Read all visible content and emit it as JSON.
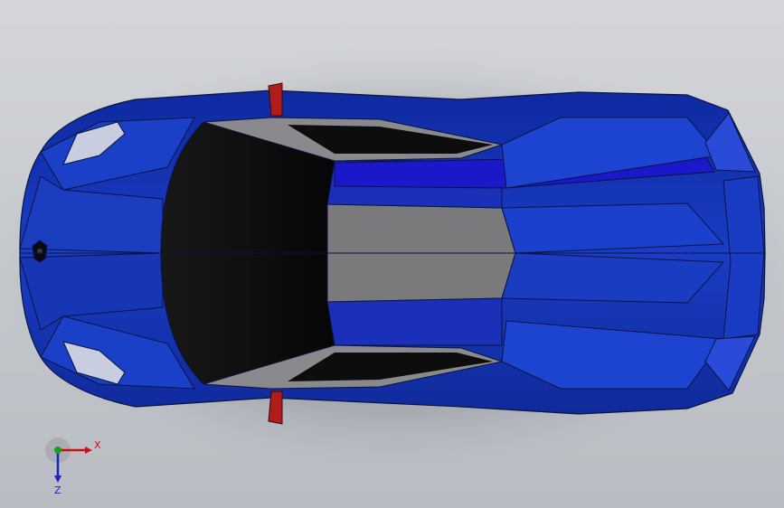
{
  "viewport": {
    "model": "car-top-view",
    "colors": {
      "background_top": "#d4d6da",
      "background_bottom": "#b9bcc2",
      "body_blue": "#1536b8",
      "body_dark_blue": "#0f2a94",
      "stripe_blue": "#1a18c8",
      "glass_black": "#0a0a0a",
      "roof_gray": "#7a7a7c",
      "mirror_red": "#b01c1c",
      "edge_line": "#0a1440"
    }
  },
  "triad": {
    "x_label": "X",
    "z_label": "Z",
    "colors": {
      "x_axis": "#d01010",
      "y_axis": "#18a018",
      "z_axis": "#1a22c8"
    }
  }
}
